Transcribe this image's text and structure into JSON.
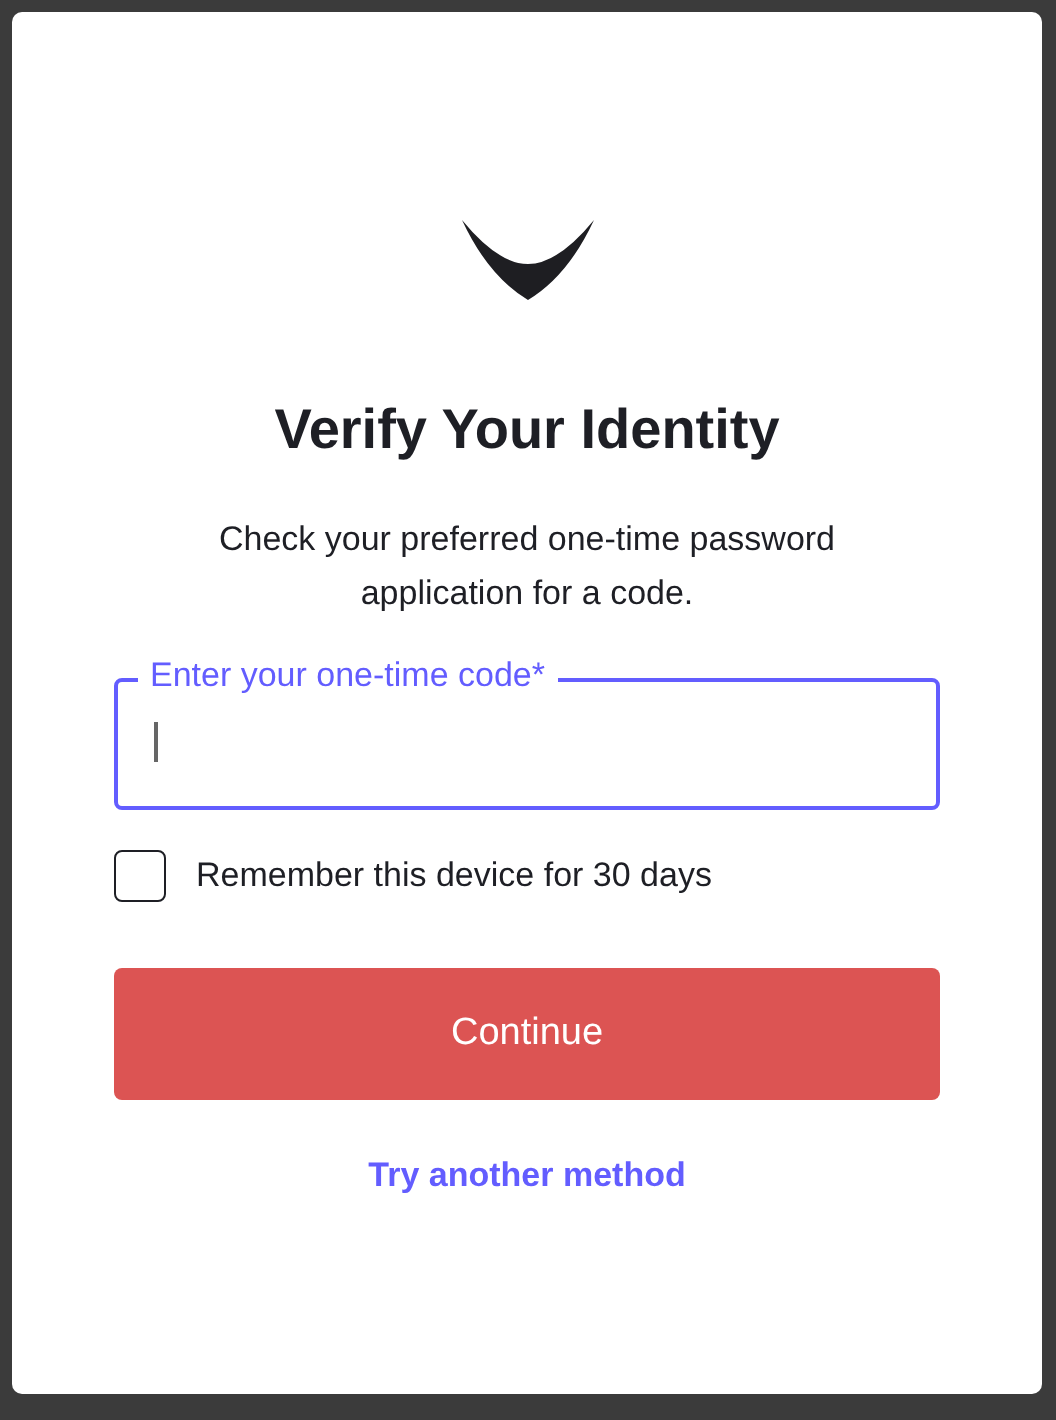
{
  "title": "Verify Your Identity",
  "description": "Check your preferred one-time password application for a code.",
  "code_field": {
    "label": "Enter your one-time code*",
    "focused": true
  },
  "remember": {
    "label": "Remember this device for 30 days",
    "checked": false
  },
  "buttons": [
    "Continue"
  ],
  "link": "Try another method"
}
